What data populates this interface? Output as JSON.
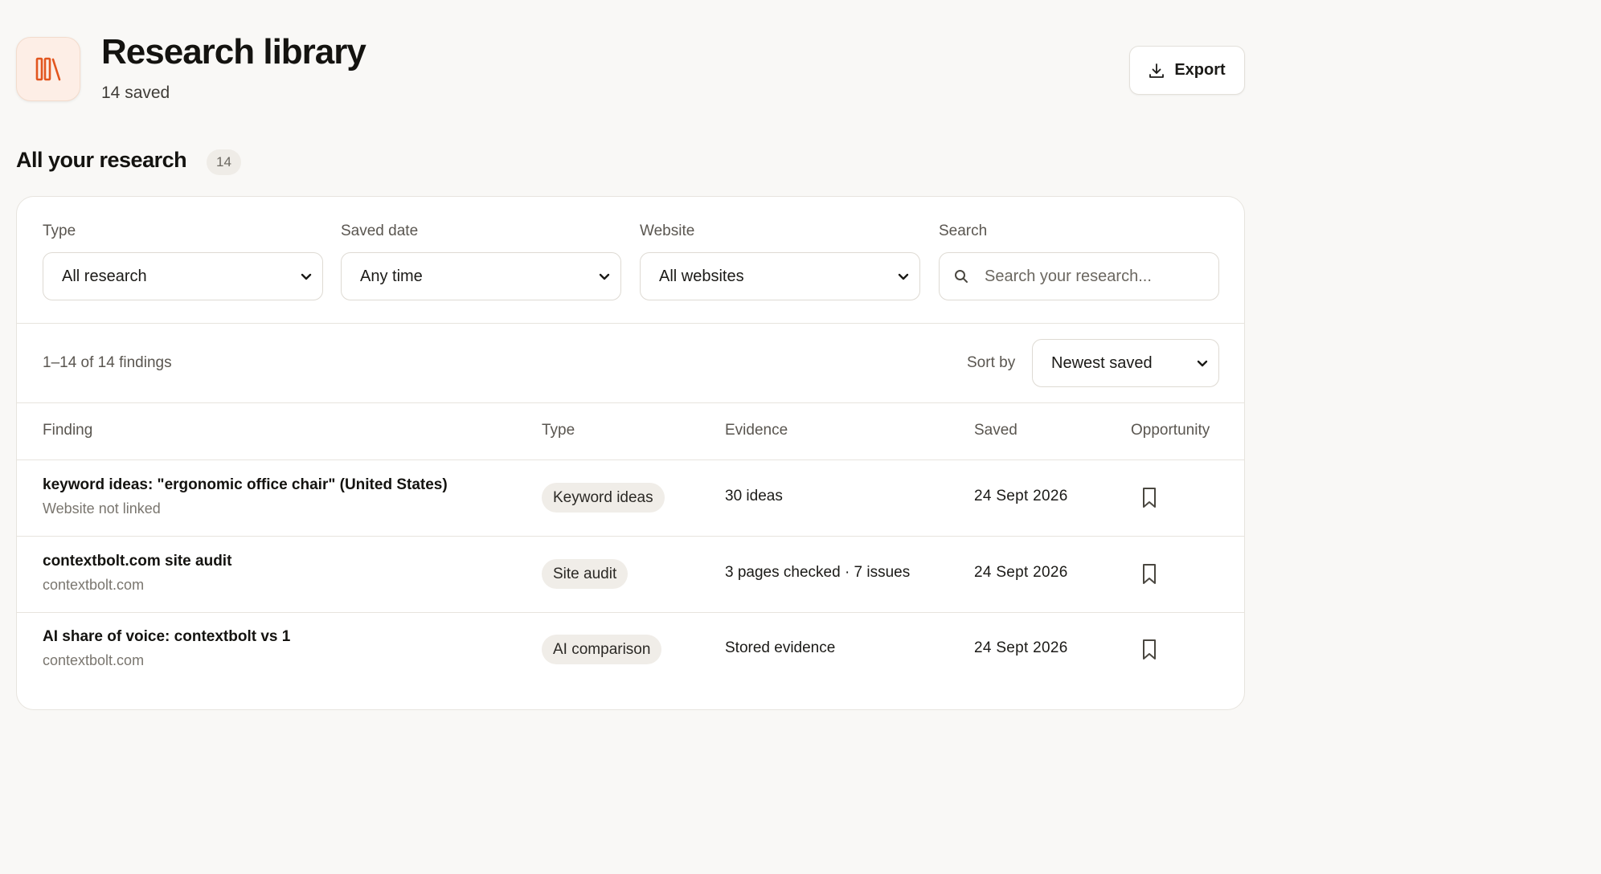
{
  "header": {
    "title": "Research library",
    "subtitle": "14 saved",
    "icon": "library-books-icon",
    "accent_color": "#e2561f",
    "export_label": "Export"
  },
  "section": {
    "title": "All your research",
    "count": "14"
  },
  "filters": {
    "type": {
      "label": "Type",
      "value": "All research"
    },
    "saved_date": {
      "label": "Saved date",
      "value": "Any time"
    },
    "website": {
      "label": "Website",
      "value": "All websites"
    },
    "search": {
      "label": "Search",
      "placeholder": "Search your research..."
    }
  },
  "results": {
    "count_text": "1–14 of 14 findings",
    "sort_label": "Sort by",
    "sort_value": "Newest saved"
  },
  "table": {
    "columns": [
      "Finding",
      "Type",
      "Evidence",
      "Saved",
      "Opportunity"
    ],
    "rows": [
      {
        "title": "keyword ideas: \"ergonomic office chair\" (United States)",
        "site": "Website not linked",
        "type": "Keyword ideas",
        "evidence": "30 ideas",
        "saved": "24 Sept 2026"
      },
      {
        "title": "contextbolt.com site audit",
        "site": "contextbolt.com",
        "type": "Site audit",
        "evidence": "3 pages checked · 7 issues",
        "saved": "24 Sept 2026"
      },
      {
        "title": "AI share of voice: contextbolt vs 1",
        "site": "contextbolt.com",
        "type": "AI comparison",
        "evidence": "Stored evidence",
        "saved": "24 Sept 2026"
      }
    ]
  }
}
